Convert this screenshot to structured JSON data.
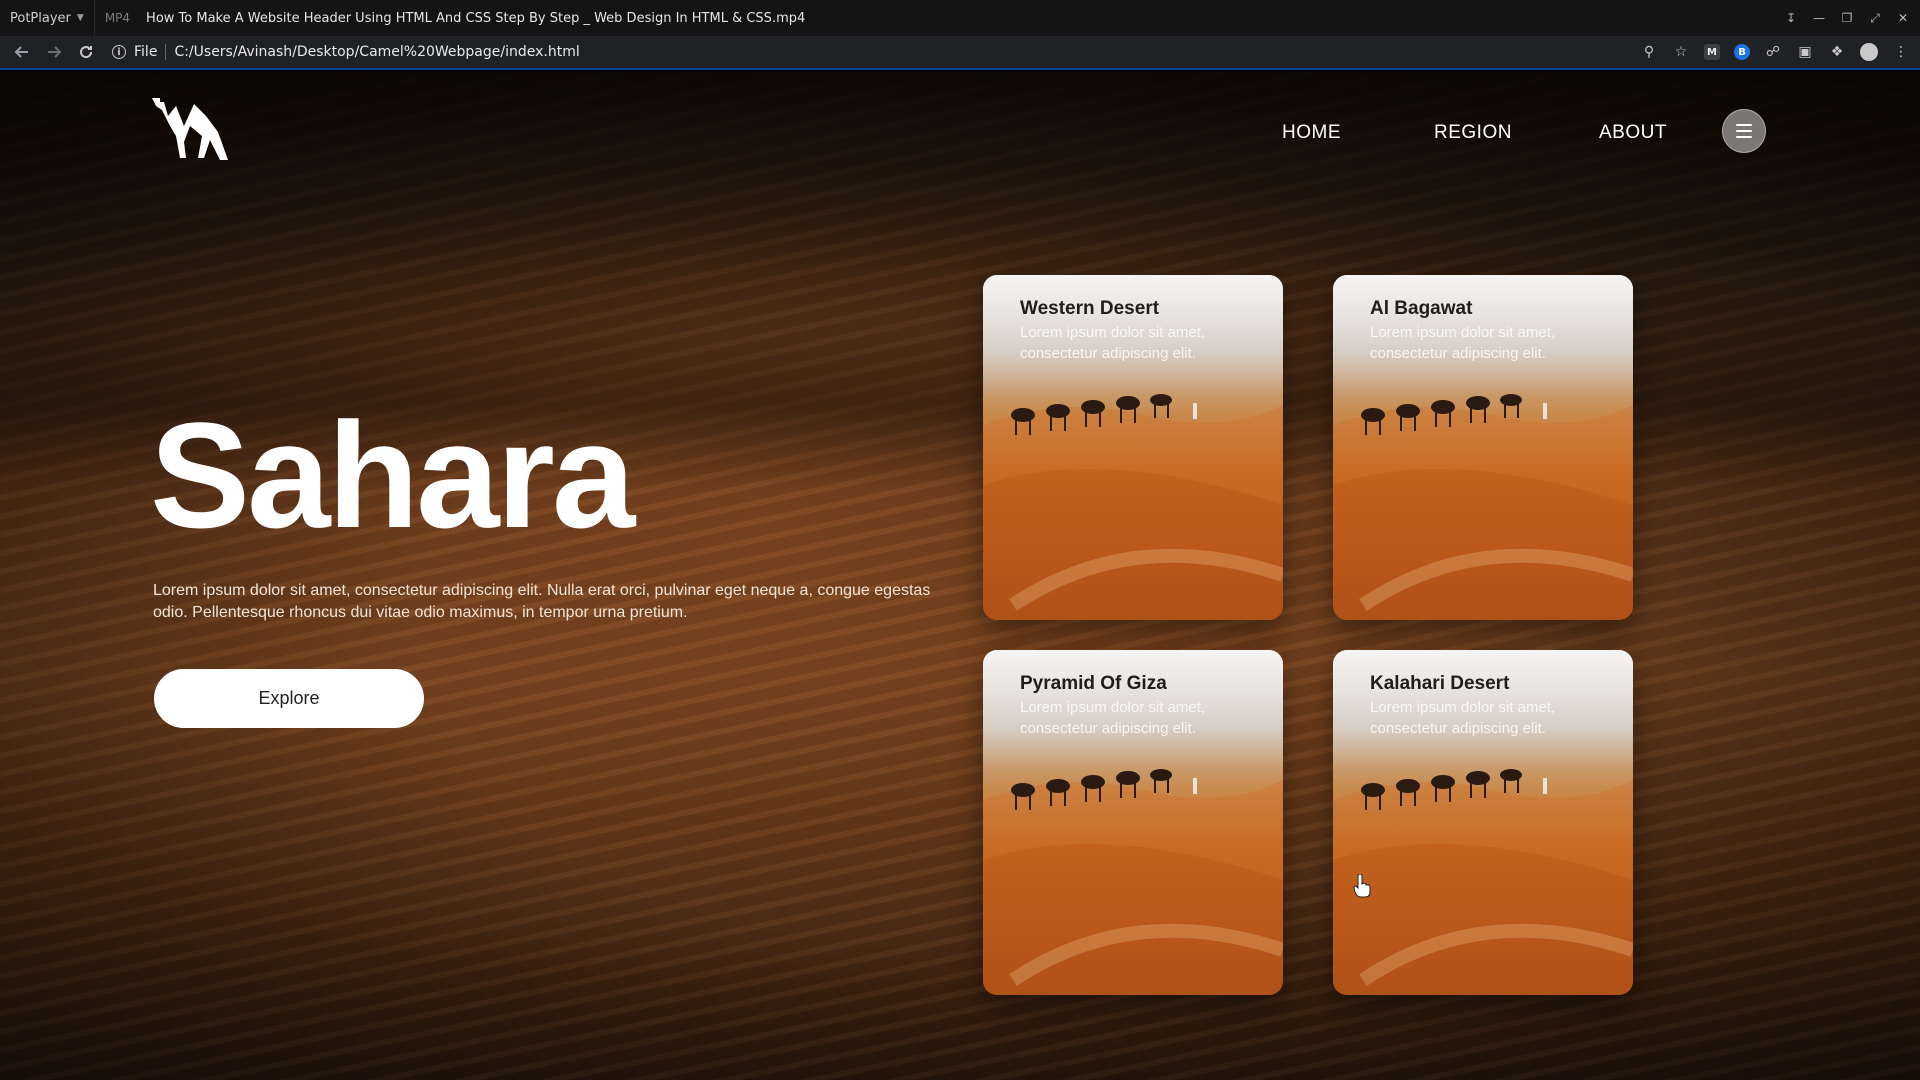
{
  "player": {
    "brand": "PotPlayer",
    "format": "MP4",
    "title": "How To Make A Website Header Using HTML And CSS Step By Step _ Web Design In HTML & CSS.mp4"
  },
  "browser": {
    "file_label": "File",
    "url": "C:/Users/Avinash/Desktop/Camel%20Webpage/index.html"
  },
  "site": {
    "nav": [
      "HOME",
      "REGION",
      "ABOUT"
    ],
    "hero_title": "Sahara",
    "hero_text": "Lorem ipsum dolor sit amet, consectetur adipiscing elit. Nulla erat orci, pulvinar eget neque a, congue egestas odio. Pellentesque rhoncus dui vitae odio maximus, in tempor urna pretium.",
    "cta_label": "Explore",
    "cards": [
      {
        "title": "Western Desert",
        "text": "Lorem ipsum dolor sit amet, consectetur adipiscing elit."
      },
      {
        "title": "Al Bagawat",
        "text": "Lorem ipsum dolor sit amet, consectetur adipiscing elit."
      },
      {
        "title": "Pyramid Of Giza",
        "text": "Lorem ipsum dolor sit amet, consectetur adipiscing elit."
      },
      {
        "title": "Kalahari Desert",
        "text": "Lorem ipsum dolor sit amet, consectetur adipiscing elit."
      }
    ]
  },
  "icons": {
    "logo": "camel-logo-icon",
    "menu": "hamburger-menu-icon"
  },
  "colors": {
    "accent_card_sand": "#c66a22",
    "button_bg": "#ffffff",
    "browser_bar": "#202124"
  }
}
